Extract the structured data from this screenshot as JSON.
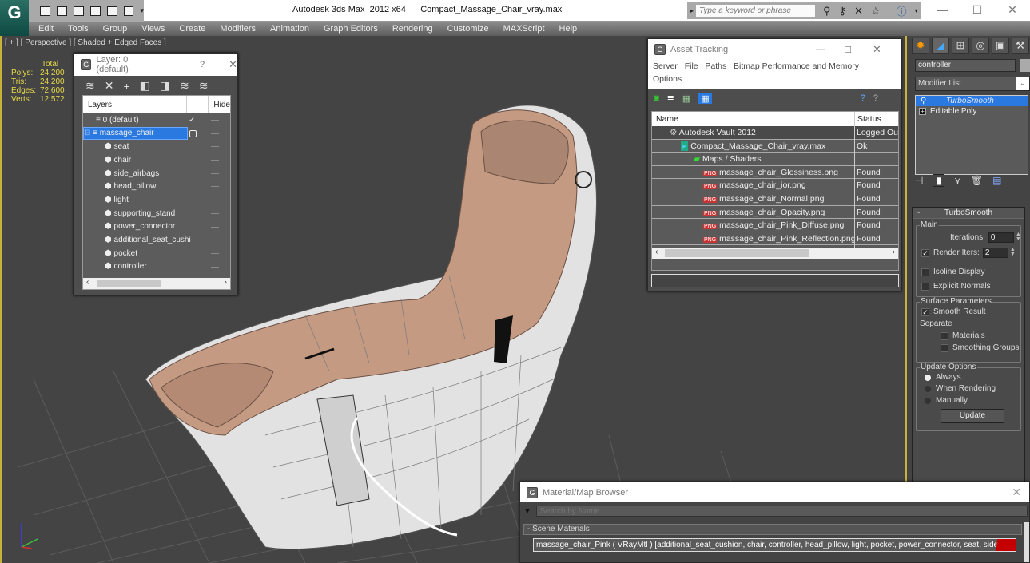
{
  "window": {
    "app_title": "Autodesk 3ds Max  2012 x64",
    "file_name": "Compact_Massage_Chair_vray.max",
    "search_placeholder": "Type a keyword or phrase",
    "logo": "G"
  },
  "menubar": [
    "Edit",
    "Tools",
    "Group",
    "Views",
    "Create",
    "Modifiers",
    "Animation",
    "Graph Editors",
    "Rendering",
    "Customize",
    "MAXScript",
    "Help"
  ],
  "viewport": {
    "label": "[ + ] [ Perspective ] [ Shaded + Edged Faces ]",
    "stats": {
      "header": "Total",
      "rows": [
        {
          "label": "Polys:",
          "value": "24 200"
        },
        {
          "label": "Tris:",
          "value": "24 200"
        },
        {
          "label": "Edges:",
          "value": "72 600"
        },
        {
          "label": "Verts:",
          "value": "12 572"
        }
      ]
    }
  },
  "layer_dialog": {
    "title": "Layer: 0 (default)",
    "help": "?",
    "columns": {
      "layers": "Layers",
      "hide": "Hide"
    },
    "layers": [
      {
        "name": "0 (default)",
        "level": 0,
        "current": true
      },
      {
        "name": "massage_chair",
        "level": 0,
        "selected": true
      },
      {
        "name": "seat",
        "level": 1
      },
      {
        "name": "chair",
        "level": 1
      },
      {
        "name": "side_airbags",
        "level": 1
      },
      {
        "name": "head_pillow",
        "level": 1
      },
      {
        "name": "light",
        "level": 1
      },
      {
        "name": "supporting_stand",
        "level": 1
      },
      {
        "name": "power_connector",
        "level": 1
      },
      {
        "name": "additional_seat_cushi",
        "level": 1
      },
      {
        "name": "pocket",
        "level": 1
      },
      {
        "name": "controller",
        "level": 1
      }
    ]
  },
  "asset_dialog": {
    "title": "Asset Tracking",
    "menu": [
      "Server",
      "File",
      "Paths",
      "Bitmap Performance and Memory",
      "Options"
    ],
    "columns": {
      "name": "Name",
      "status": "Status"
    },
    "rows": [
      {
        "name": "Autodesk Vault 2012",
        "status": "Logged Ou",
        "indent": 1,
        "icon": "vault"
      },
      {
        "name": "Compact_Massage_Chair_vray.max",
        "status": "Ok",
        "indent": 2,
        "icon": "max"
      },
      {
        "name": "Maps / Shaders",
        "status": "",
        "indent": 3,
        "icon": "maps"
      },
      {
        "name": "massage_chair_Glossiness.png",
        "status": "Found",
        "indent": 4,
        "icon": "png"
      },
      {
        "name": "massage_chair_ior.png",
        "status": "Found",
        "indent": 4,
        "icon": "png"
      },
      {
        "name": "massage_chair_Normal.png",
        "status": "Found",
        "indent": 4,
        "icon": "png"
      },
      {
        "name": "massage_chair_Opacity.png",
        "status": "Found",
        "indent": 4,
        "icon": "png"
      },
      {
        "name": "massage_chair_Pink_Diffuse.png",
        "status": "Found",
        "indent": 4,
        "icon": "png"
      },
      {
        "name": "massage_chair_Pink_Reflection.png",
        "status": "Found",
        "indent": 4,
        "icon": "png"
      }
    ]
  },
  "command_panel": {
    "object_name": "controller",
    "modifier_list": "Modifier List",
    "stack": [
      {
        "name": "TurboSmooth",
        "selected": true
      },
      {
        "name": "Editable Poly",
        "selected": false
      }
    ],
    "rollout_title": "TurboSmooth",
    "main_group": "Main",
    "iterations_label": "Iterations:",
    "iterations_value": "0",
    "render_iters_label": "Render Iters:",
    "render_iters_value": "2",
    "render_iters_checked": true,
    "isoline_label": "Isoline Display",
    "explicit_normals_label": "Explicit Normals",
    "surface_group": "Surface Parameters",
    "smooth_result_label": "Smooth Result",
    "separate_label": "Separate",
    "materials_label": "Materials",
    "smoothing_groups_label": "Smoothing Groups",
    "update_group": "Update Options",
    "update_options": [
      {
        "label": "Always",
        "selected": true
      },
      {
        "label": "When Rendering",
        "selected": false
      },
      {
        "label": "Manually",
        "selected": false
      }
    ],
    "update_button": "Update"
  },
  "material_browser": {
    "title": "Material/Map Browser",
    "search_placeholder": "Search by Name ...",
    "section": "- Scene Materials",
    "material": "massage_chair_Pink ( VRayMtl ) [additional_seat_cushion, chair, controller, head_pillow, light, pocket, power_connector, seat, side_ai..."
  },
  "colors": {
    "selection_blue": "#2a79e0",
    "stats_yellow": "#e6d94a",
    "viewport_border": "#c9b13a",
    "chair_pink": "#c49a82",
    "chair_white": "#e4e4e4"
  }
}
